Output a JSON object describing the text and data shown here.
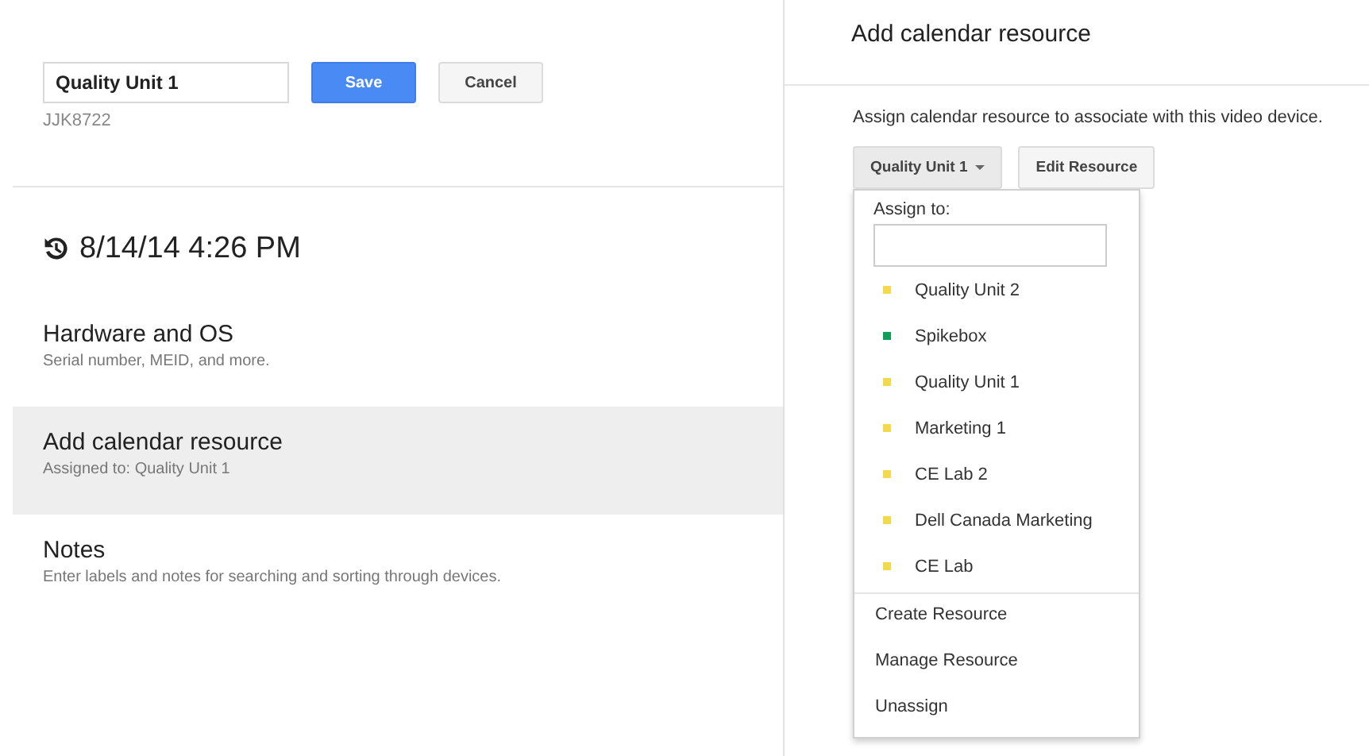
{
  "device": {
    "name_value": "Quality Unit 1",
    "save": "Save",
    "cancel": "Cancel",
    "serial": "JJK8722",
    "last_sync": "8/14/14 4:26 PM"
  },
  "sections": [
    {
      "title": "Hardware and OS",
      "subtitle": "Serial number, MEID, and more.",
      "selected": false
    },
    {
      "title": "Add calendar resource",
      "subtitle": "Assigned to: Quality Unit 1",
      "selected": true
    },
    {
      "title": "Notes",
      "subtitle": "Enter labels and notes for searching and sorting through devices.",
      "selected": false
    }
  ],
  "panel": {
    "title": "Add calendar resource",
    "description": "Assign calendar resource to associate with this video device.",
    "dropdown_button": "Quality Unit 1",
    "edit_button": "Edit Resource"
  },
  "menu": {
    "label": "Assign to:",
    "resources": [
      {
        "name": "Quality Unit 2",
        "color": "#f2d94e"
      },
      {
        "name": "Spikebox",
        "color": "#0f9d58"
      },
      {
        "name": "Quality Unit 1",
        "color": "#f2d94e"
      },
      {
        "name": "Marketing 1",
        "color": "#f2d94e"
      },
      {
        "name": "CE Lab 2",
        "color": "#f2d94e"
      },
      {
        "name": "Dell Canada Marketing",
        "color": "#f2d94e"
      },
      {
        "name": "CE Lab",
        "color": "#f2d94e"
      }
    ],
    "actions": [
      "Create Resource",
      "Manage Resource",
      "Unassign"
    ]
  }
}
